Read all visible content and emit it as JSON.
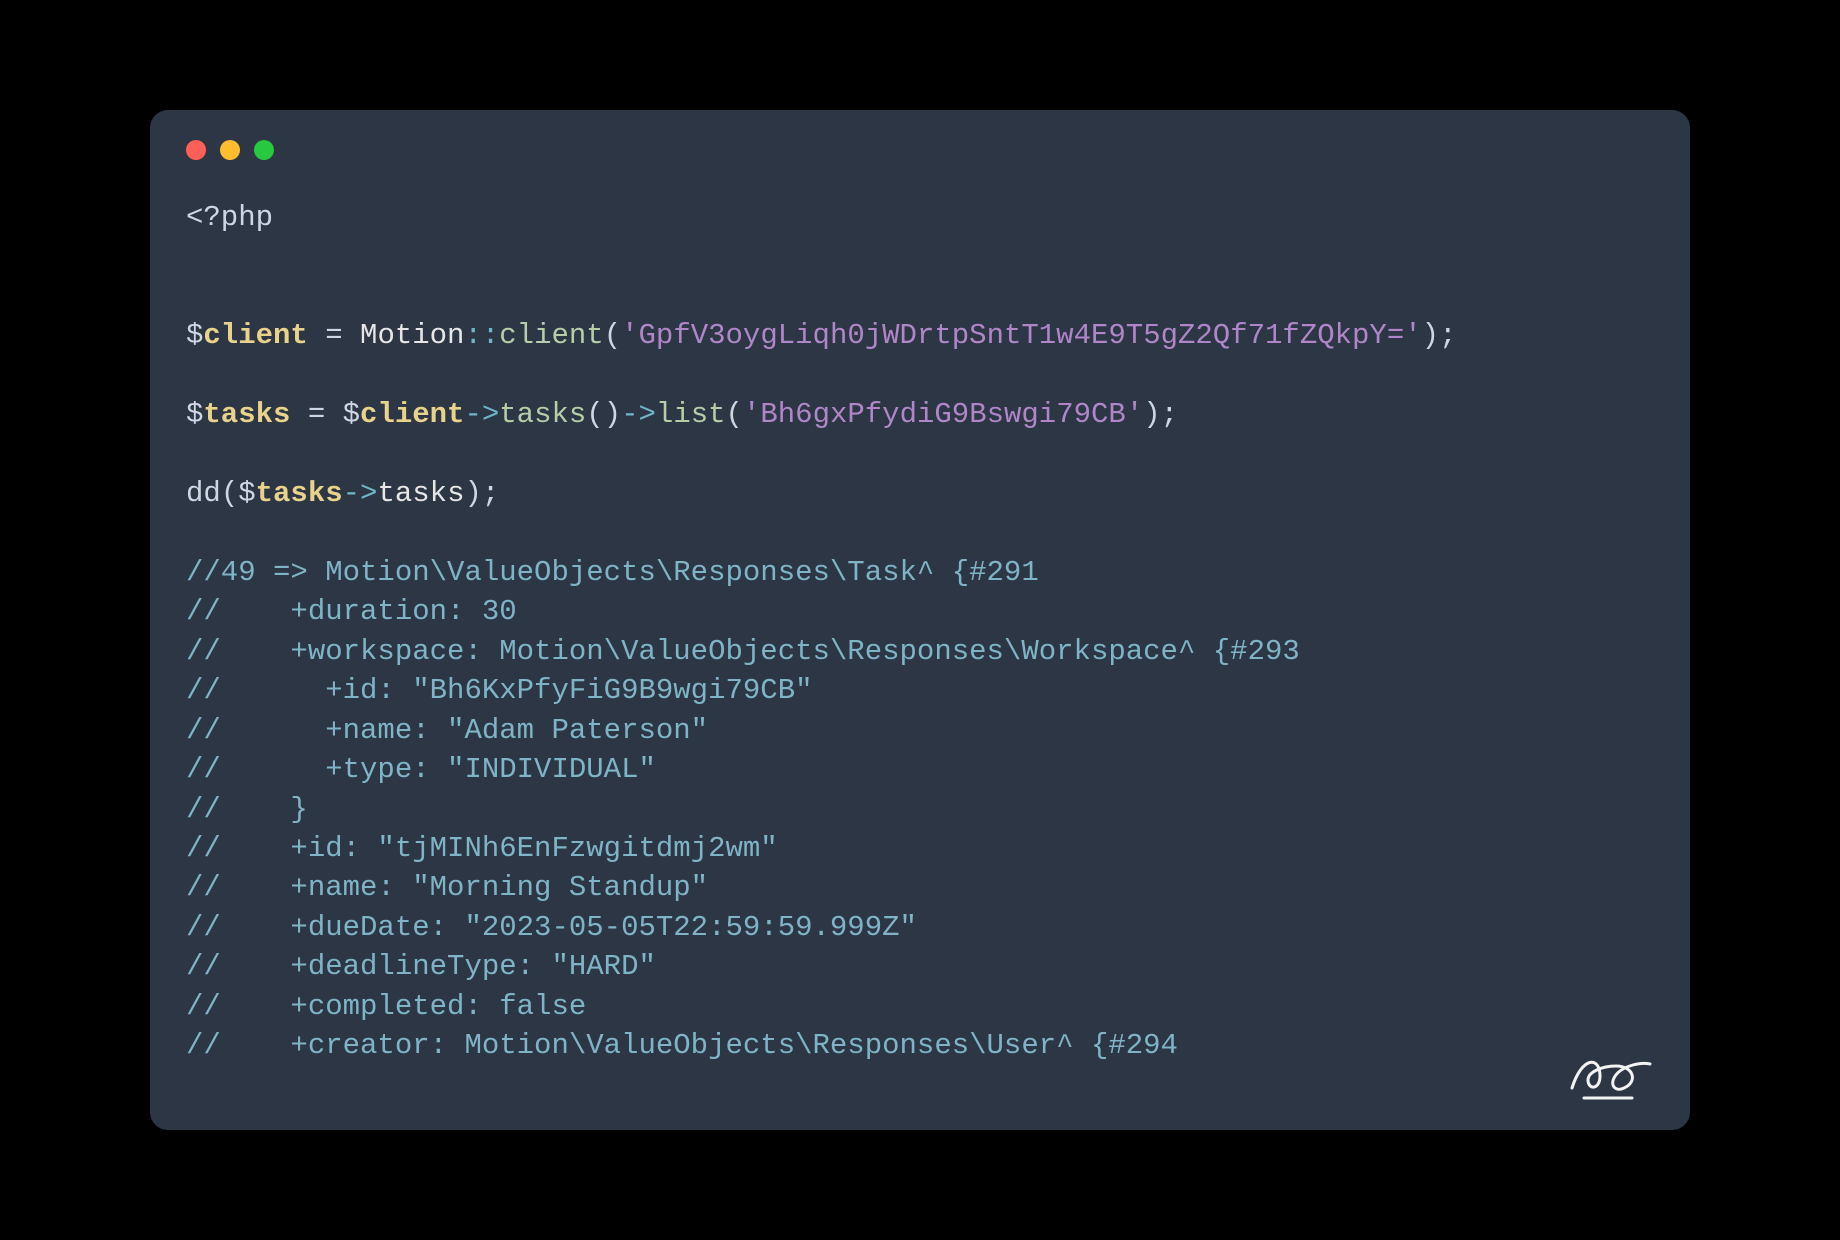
{
  "colors": {
    "window_bg": "#2c3644",
    "page_bg": "#000000",
    "string": "#b086c9",
    "comment": "#7fb4c6",
    "variable": "#e9d28a"
  },
  "traffic_lights": [
    "red",
    "yellow",
    "green"
  ],
  "code": {
    "open_tag": "<?php",
    "line_client": {
      "sigil1": "$",
      "var1": "client",
      "eq1": " = ",
      "class": "Motion",
      "scope": "::",
      "method": "client",
      "p1": "(",
      "q1": "'",
      "arg": "GpfV3oygLiqh0jWDrtpSntT1w4E9T5gZ2Qf71fZQkpY=",
      "q2": "'",
      "p2": ")",
      "semi": ";"
    },
    "line_tasks": {
      "sigil1": "$",
      "var1": "tasks",
      "eq1": " = ",
      "sigil2": "$",
      "var2": "client",
      "arrow1": "->",
      "m1": "tasks",
      "p1": "()",
      "arrow2": "->",
      "m2": "list",
      "p2a": "(",
      "q1": "'",
      "arg": "Bh6gxPfydiG9Bswgi79CB",
      "q2": "'",
      "p2b": ")",
      "semi": ";"
    },
    "line_dd": {
      "fn": "dd",
      "p1": "(",
      "sigil": "$",
      "var": "tasks",
      "arrow": "->",
      "prop": "tasks",
      "p2": ")",
      "semi": ";"
    },
    "comments": [
      "//49 => Motion\\ValueObjects\\Responses\\Task^ {#291",
      "//    +duration: 30",
      "//    +workspace: Motion\\ValueObjects\\Responses\\Workspace^ {#293",
      "//      +id: \"Bh6KxPfyFiG9B9wgi79CB\"",
      "//      +name: \"Adam Paterson\"",
      "//      +type: \"INDIVIDUAL\"",
      "//    }",
      "//    +id: \"tjMINh6EnFzwgitdmj2wm\"",
      "//    +name: \"Morning Standup\"",
      "//    +dueDate: \"2023-05-05T22:59:59.999Z\"",
      "//    +deadlineType: \"HARD\"",
      "//    +completed: false",
      "//    +creator: Motion\\ValueObjects\\Responses\\User^ {#294"
    ]
  },
  "signature_initials": "AP"
}
